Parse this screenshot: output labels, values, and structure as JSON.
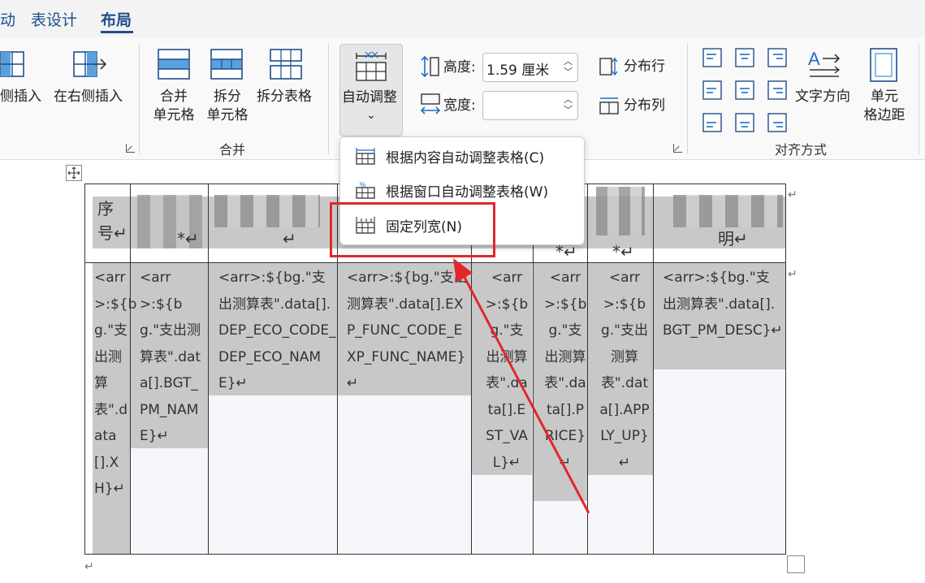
{
  "tabs": {
    "partial": "动",
    "table_design": "表设计",
    "layout": "布局"
  },
  "ribbon": {
    "insert_left_label": "侧插入",
    "insert_right_label": "在右侧插入",
    "merge_cells_label_1": "合并",
    "merge_cells_label_2": "单元格",
    "split_cells_label_1": "拆分",
    "split_cells_label_2": "单元格",
    "split_table_label": "拆分表格",
    "merge_group_label": "合并",
    "autofit_label": "自动调整",
    "autofit_chevron": "⌄",
    "height_label": "高度:",
    "height_value": "1.59 厘米",
    "width_label": "宽度:",
    "width_value": "",
    "distribute_rows_label": "分布行",
    "distribute_cols_label": "分布列",
    "text_direction_label": "文字方向",
    "cell_margin_label_1": "单元",
    "cell_margin_label_2": "格边距",
    "align_group_label": "对齐方式"
  },
  "dropdown": {
    "items": [
      {
        "label": "根据内容自动调整表格(C)"
      },
      {
        "label": "根据窗口自动调整表格(W)"
      },
      {
        "label": "固定列宽(N)"
      }
    ]
  },
  "table": {
    "headers": [
      {
        "line1": "序",
        "line2": "号↵"
      },
      {
        "line1": "",
        "line2": "*↵"
      },
      {
        "line1": "",
        "line2": "↵"
      },
      {
        "line1": "",
        "line2": ""
      },
      {
        "line1": "",
        "line2": ""
      },
      {
        "line1": "",
        "line2": "*↵"
      },
      {
        "line1": "",
        "line2": "*↵"
      },
      {
        "line1": "",
        "line2": "明↵"
      }
    ],
    "cells": [
      "<arr>:${bg.\"支出测算表\".data[].XH}↵",
      "<arr>:${bg.\"支出测算表\".data[].BGT_PM_NAME}↵",
      "<arr>:${bg.\"支出测算表\".data[].DEP_ECO_CODE_DEP_ECO_NAME}↵",
      "<arr>:${bg.\"支出测算表\".data[].EXP_FUNC_CODE_EXP_FUNC_NAME}↵",
      "<arr>:${bg.\"支出测算表\".data[].EST_VAL}↵",
      "<arr>:${bg.\"支出测算表\".data[].PRICE}↵",
      "<arr>:${bg.\"支出测算表\".data[].APPLY_UP}↵",
      "<arr>:${bg.\"支出测算表\".data[].BGT_PM_DESC}↵"
    ],
    "end_mark": "↵"
  },
  "colors": {
    "accent": "#1e4e8c",
    "highlight": "#e0282c",
    "cell_shade": "#c8c8c8"
  }
}
